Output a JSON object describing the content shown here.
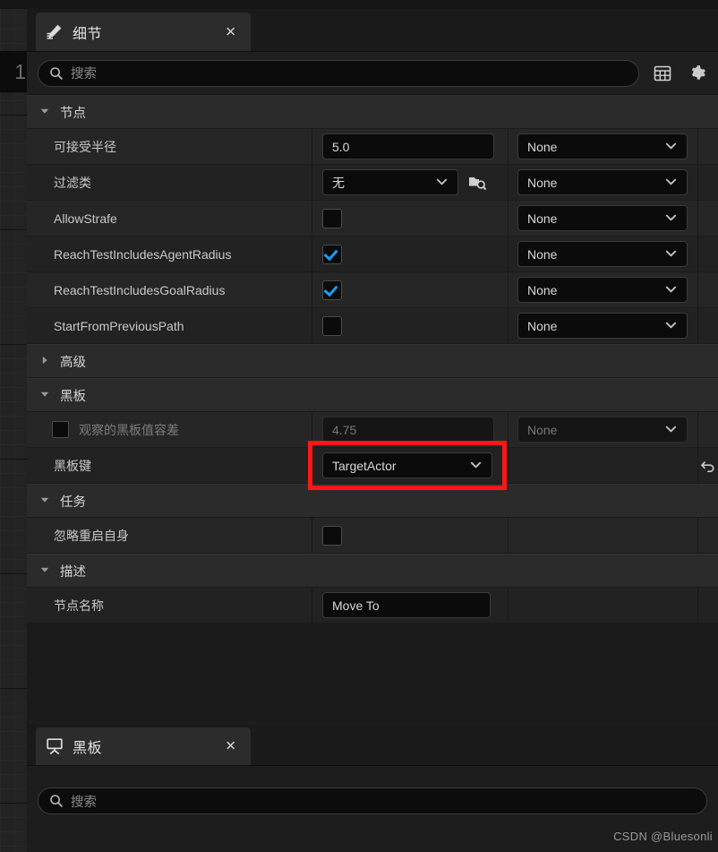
{
  "background": {
    "node_chip_label": "1"
  },
  "details_panel": {
    "tab": {
      "icon": "details-pencil-icon",
      "label": "细节",
      "close_label": "✕"
    },
    "search": {
      "icon": "search-icon",
      "placeholder": "搜索",
      "value": ""
    },
    "toolbar": {
      "columns_icon": "table-columns-icon",
      "settings_icon": "gear-icon"
    },
    "sections": [
      {
        "id": "node",
        "label": "节点",
        "expanded": true,
        "caret": "▼",
        "rows": [
          {
            "name": "可接受半径",
            "type": "number",
            "value": "5.0",
            "binding": "None",
            "binding_chevron": "⌄"
          },
          {
            "name": "过滤类",
            "type": "enum",
            "value": "无",
            "value_chevron": "⌄",
            "browse_icon": "browse-content-icon",
            "binding": "None",
            "binding_chevron": "⌄"
          },
          {
            "name": "AllowStrafe",
            "type": "checkbox",
            "checked": false,
            "binding": "None",
            "binding_chevron": "⌄"
          },
          {
            "name": "ReachTestIncludesAgentRadius",
            "type": "checkbox",
            "checked": true,
            "binding": "None",
            "binding_chevron": "⌄"
          },
          {
            "name": "ReachTestIncludesGoalRadius",
            "type": "checkbox",
            "checked": true,
            "binding": "None",
            "binding_chevron": "⌄"
          },
          {
            "name": "StartFromPreviousPath",
            "type": "checkbox",
            "checked": false,
            "binding": "None",
            "binding_chevron": "⌄"
          }
        ]
      },
      {
        "id": "advanced",
        "label": "高级",
        "expanded": false,
        "caret": "▶",
        "rows": []
      },
      {
        "id": "blackboard",
        "label": "黑板",
        "expanded": true,
        "caret": "▼",
        "rows": [
          {
            "name": "观察的黑板值容差",
            "type": "number",
            "has_name_checkbox": true,
            "name_checkbox_checked": false,
            "disabled": true,
            "value": "4.75",
            "binding": "None",
            "binding_chevron": "⌄"
          },
          {
            "name": "黑板键",
            "type": "combo",
            "value": "TargetActor",
            "value_chevron": "⌄",
            "reset_icon": "reset-arrow-icon",
            "highlighted": true
          }
        ]
      },
      {
        "id": "task",
        "label": "任务",
        "expanded": true,
        "caret": "▼",
        "rows": [
          {
            "name": "忽略重启自身",
            "type": "checkbox",
            "checked": false
          }
        ]
      },
      {
        "id": "description",
        "label": "描述",
        "expanded": true,
        "caret": "▼",
        "rows": [
          {
            "name": "节点名称",
            "type": "text",
            "value": "Move To"
          }
        ]
      }
    ]
  },
  "blackboard_panel": {
    "tab": {
      "icon": "blackboard-easel-icon",
      "label": "黑板",
      "close_label": "✕"
    },
    "search": {
      "icon": "search-icon",
      "placeholder": "搜索",
      "value": ""
    }
  },
  "watermark": {
    "text": "CSDN @Bluesonli"
  },
  "colors": {
    "accent_checkbox": "#1a9cf5",
    "highlight_box": "#ff1616",
    "panel_bg": "#1d1d1d",
    "row_bg": "#262626",
    "section_bg": "#2b2b2b",
    "field_bg": "#0b0b0b"
  }
}
